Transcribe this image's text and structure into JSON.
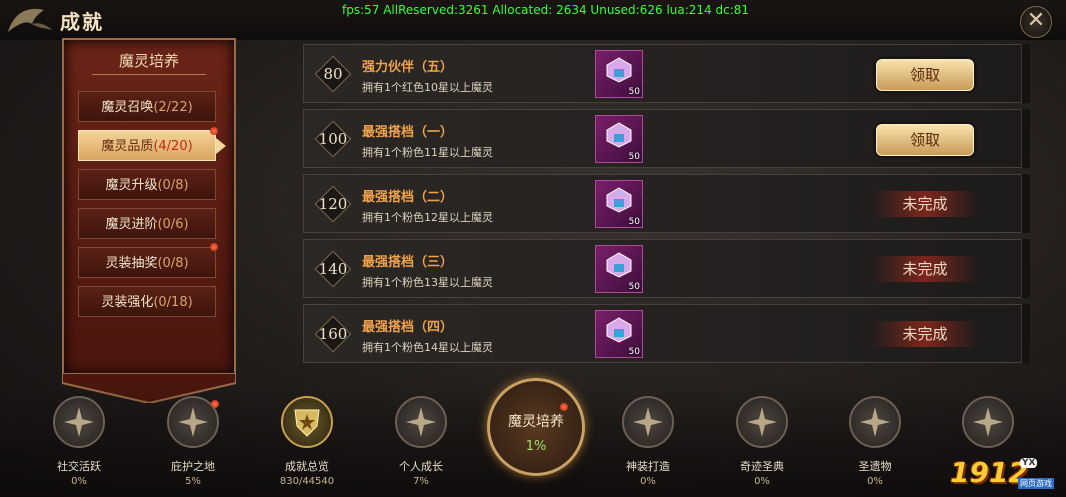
{
  "header": {
    "title": "成就",
    "debug": "fps:57 AllReserved:3261 Allocated: 2634 Unused:626 lua:214 dc:81"
  },
  "sidebar": {
    "title": "魔灵培养",
    "items": [
      {
        "label": "魔灵召唤",
        "count": "(2/22)"
      },
      {
        "label": "魔灵品质",
        "count": "(4/20)"
      },
      {
        "label": "魔灵升级",
        "count": "(0/8)"
      },
      {
        "label": "魔灵进阶",
        "count": "(0/6)"
      },
      {
        "label": "灵装抽奖",
        "count": "(0/8)"
      },
      {
        "label": "灵装强化",
        "count": "(0/18)"
      }
    ]
  },
  "achievements": [
    {
      "points": "80",
      "title": "强力伙伴（五）",
      "desc": "拥有1个红色10星以上魔灵",
      "qty": "50",
      "action": "领取"
    },
    {
      "points": "100",
      "title": "最强搭档（一）",
      "desc": "拥有1个粉色11星以上魔灵",
      "qty": "50",
      "action": "领取"
    },
    {
      "points": "120",
      "title": "最强搭档（二）",
      "desc": "拥有1个粉色12星以上魔灵",
      "qty": "50",
      "action": "未完成"
    },
    {
      "points": "140",
      "title": "最强搭档（三）",
      "desc": "拥有1个粉色13星以上魔灵",
      "qty": "50",
      "action": "未完成"
    },
    {
      "points": "160",
      "title": "最强搭档（四）",
      "desc": "拥有1个粉色14星以上魔灵",
      "qty": "50",
      "action": "未完成"
    }
  ],
  "bottom": [
    {
      "label": "社交活跃",
      "pct": "0%"
    },
    {
      "label": "庇护之地",
      "pct": "5%"
    },
    {
      "label": "成就总览",
      "pct": "830/44540"
    },
    {
      "label": "个人成长",
      "pct": "7%"
    },
    {
      "label": "神装打造",
      "pct": "0%"
    },
    {
      "label": "奇迹圣典",
      "pct": "0%"
    },
    {
      "label": "圣遗物",
      "pct": "0%"
    },
    {
      "label": "",
      "pct": ""
    }
  ],
  "active_category": {
    "label": "魔灵培养",
    "pct": "1%"
  },
  "watermark": {
    "number": "1912",
    "badge": "YX",
    "sub": "网页游戏"
  },
  "colors": {
    "accent": "#f0a24a",
    "progress": "#9be06a",
    "claim_button": "#d9a65e"
  }
}
